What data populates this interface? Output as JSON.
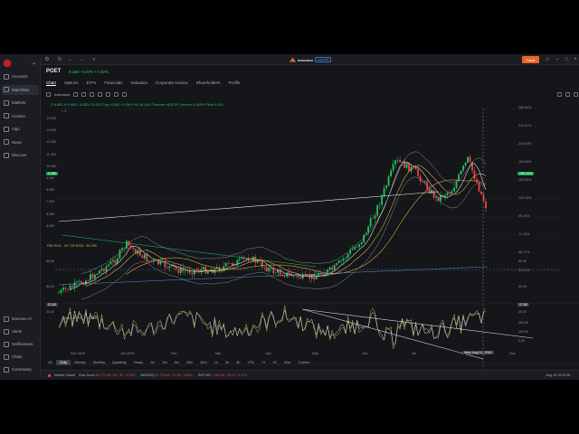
{
  "app": {
    "brand_name": "moomoo",
    "brand_tag": "Upgrade",
    "trade_label": "Trade"
  },
  "sidebar": {
    "items": [
      {
        "label": "Accounts",
        "icon": "wallet-icon"
      },
      {
        "label": "Watchlists",
        "icon": "star-icon",
        "active": true
      },
      {
        "label": "Markets",
        "icon": "globe-icon"
      },
      {
        "label": "Custom",
        "icon": "grid-icon"
      },
      {
        "label": "Algo",
        "icon": "algo-icon"
      },
      {
        "label": "News",
        "icon": "news-icon"
      },
      {
        "label": "Discover",
        "icon": "compass-icon"
      }
    ],
    "bottom_items": [
      {
        "label": "Moomoo AI",
        "icon": "ai-icon"
      },
      {
        "label": "Alerts",
        "icon": "bell-icon"
      },
      {
        "label": "Notifications",
        "icon": "mail-icon"
      },
      {
        "label": "Chats",
        "icon": "chat-icon"
      },
      {
        "label": "Community",
        "icon": "people-icon"
      }
    ]
  },
  "quote": {
    "symbol": "POET",
    "price": "9.380",
    "change": "+0.670",
    "change_pct": "+7.92%"
  },
  "tabs": [
    "Chart",
    "Options",
    "ETFs",
    "Financials",
    "Valuation",
    "Corporate Actions",
    "Shareholders",
    "Profile"
  ],
  "toolbar": {
    "indicators_label": "Indicators"
  },
  "ohlc": {
    "text": "O 8.880  H 9.480  L 8.830  C 8.870  Chg +0.560  +0.28%  Vol 16.14M  Turnover 98.87M  Turnover 6.263%  Float 0.000",
    "meta": "× 3"
  },
  "price_axis": [
    "14.000",
    "13.000",
    "12.000",
    "11.000",
    "10.000",
    "9.000",
    "8.000",
    "7.000",
    "6.000",
    "5.000"
  ],
  "pct_axis": [
    "286.60%",
    "243.47%",
    "216.00%",
    "183.54%",
    "155.00%",
    "120.15%",
    "95.70%",
    "71.23%",
    "46.77%",
    "22.31%"
  ],
  "last_price_badge": "9.380",
  "last_pct_badge": "156.34%",
  "rsi": {
    "label": "RSI",
    "values_text": "RSI1 : 59.728   RSI3 : 55.299",
    "ticks": [
      "80.00",
      "50.00",
      "20.00"
    ],
    "left_badge": "27.83",
    "right_badge": "27.83"
  },
  "volume": {
    "label": "Volume",
    "values_text": "VOL : 15.96M",
    "ticks": [
      "200.00",
      "100.00",
      "0.00"
    ]
  },
  "x_axis": [
    "Dec 2025",
    "Jan 2026",
    "Feb",
    "Mar",
    "Apr",
    "May",
    "Jun",
    "Jul",
    "Aug",
    "Sep"
  ],
  "crosshair_date": "Wed, Aug 12, 2026",
  "ranges": [
    "1D",
    "Daily",
    "Weekly",
    "Monthly",
    "Quarterly",
    "Yearly",
    "1m",
    "3m",
    "5m",
    "15m",
    "30m",
    "1h",
    "2h",
    "4h",
    "YTD",
    "1Y",
    "5Y",
    "Max",
    "Custom"
  ],
  "active_range": "Daily",
  "status": {
    "market": "Market Closed",
    "indices": [
      {
        "name": "Dow Jones",
        "value": "50,772.45  −527.30  −0.78%"
      },
      {
        "name": "NASDAQ",
        "value": "22,775.45  −73.38  −0.80%"
      },
      {
        "name": "S&P 500",
        "value": "7,150.26  −13.23  −0.17%"
      }
    ],
    "clock": "Aug 16  12:29:38"
  },
  "colors": {
    "up": "#22c55e",
    "down": "#ef4444",
    "accent": "#e8632b",
    "bg": "#14161a"
  }
}
